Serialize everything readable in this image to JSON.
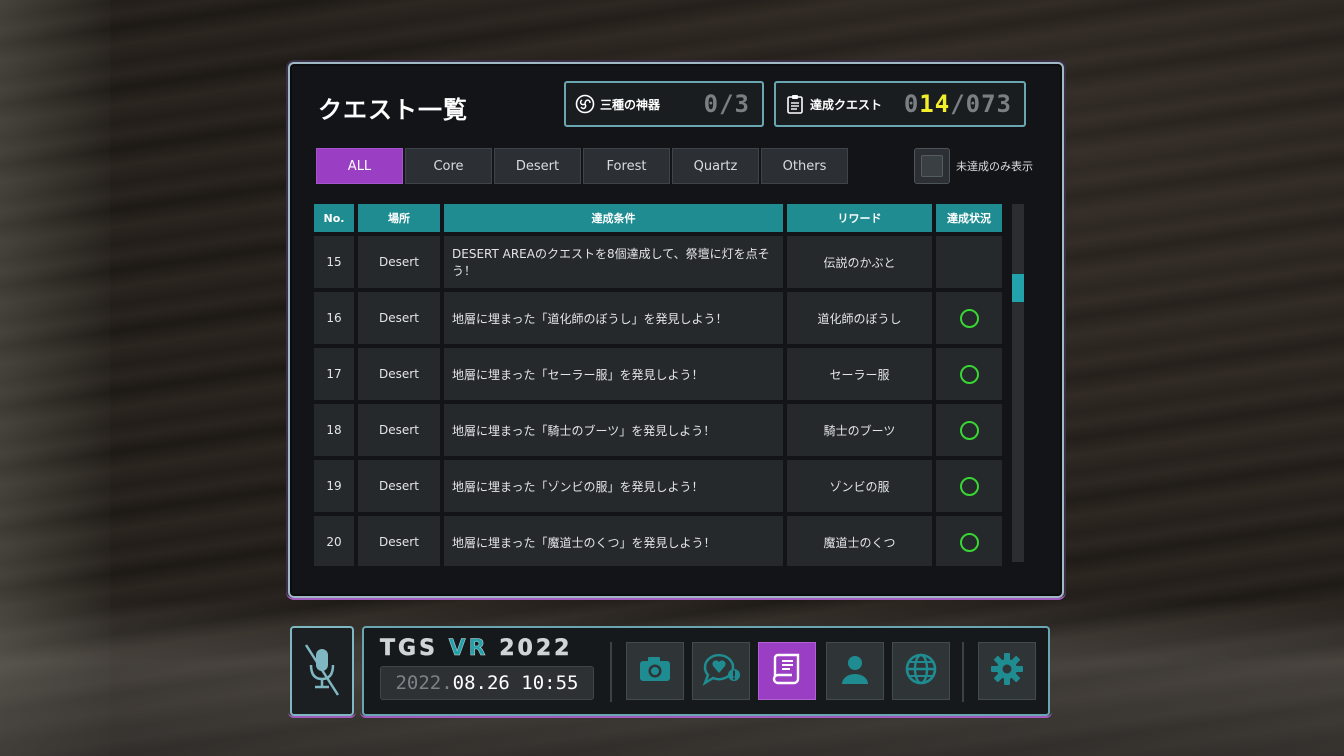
{
  "panel": {
    "title": "クエスト一覧",
    "sacred": {
      "label": "三種の神器",
      "value": "0/3",
      "icon": "triskelion-icon"
    },
    "quests": {
      "label": "達成クエスト",
      "value_dim": "0",
      "value_hi": "14",
      "value_total": "/073",
      "icon": "clipboard-icon"
    },
    "tabs": [
      {
        "label": "ALL",
        "active": true
      },
      {
        "label": "Core",
        "active": false
      },
      {
        "label": "Desert",
        "active": false
      },
      {
        "label": "Forest",
        "active": false
      },
      {
        "label": "Quartz",
        "active": false
      },
      {
        "label": "Others",
        "active": false
      }
    ],
    "filter_label": "未達成のみ表示",
    "table": {
      "headers": {
        "no": "No.",
        "place": "場所",
        "condition": "達成条件",
        "reward": "リワード",
        "status": "達成状況"
      },
      "rows": [
        {
          "no": "15",
          "place": "Desert",
          "condition": "DESERT AREAのクエストを8個達成して、祭壇に灯を点そう！",
          "reward": "伝説のかぶと",
          "done": false
        },
        {
          "no": "16",
          "place": "Desert",
          "condition": "地層に埋まった「道化師のぼうし」を発見しよう！",
          "reward": "道化師のぼうし",
          "done": true
        },
        {
          "no": "17",
          "place": "Desert",
          "condition": "地層に埋まった「セーラー服」を発見しよう！",
          "reward": "セーラー服",
          "done": true
        },
        {
          "no": "18",
          "place": "Desert",
          "condition": "地層に埋まった「騎士のブーツ」を発見しよう！",
          "reward": "騎士のブーツ",
          "done": true
        },
        {
          "no": "19",
          "place": "Desert",
          "condition": "地層に埋まった「ゾンビの服」を発見しよう！",
          "reward": "ゾンビの服",
          "done": true
        },
        {
          "no": "20",
          "place": "Desert",
          "condition": "地層に埋まった「魔道士のくつ」を発見しよう！",
          "reward": "魔道士のくつ",
          "done": true
        }
      ]
    }
  },
  "dock": {
    "brand_left": "TGS ",
    "brand_vr": "VR",
    "brand_right": " 2022",
    "date_year": "2022.",
    "date_rest": "08.26 10:55",
    "buttons": [
      {
        "name": "camera-button",
        "icon": "camera-icon",
        "active": false
      },
      {
        "name": "emote-button",
        "icon": "heart-speech-icon",
        "active": false
      },
      {
        "name": "quest-button",
        "icon": "scroll-icon",
        "active": true
      },
      {
        "name": "profile-button",
        "icon": "person-icon",
        "active": false
      },
      {
        "name": "world-button",
        "icon": "globe-icon",
        "active": false
      },
      {
        "name": "settings-button",
        "icon": "gear-icon",
        "active": false
      }
    ],
    "mic_icon": "mic-muted-icon"
  },
  "colors": {
    "accent_purple": "#9a3fc4",
    "accent_teal": "#1f8c91",
    "highlight_yellow": "#f2ee2c",
    "status_green": "#38d633"
  }
}
